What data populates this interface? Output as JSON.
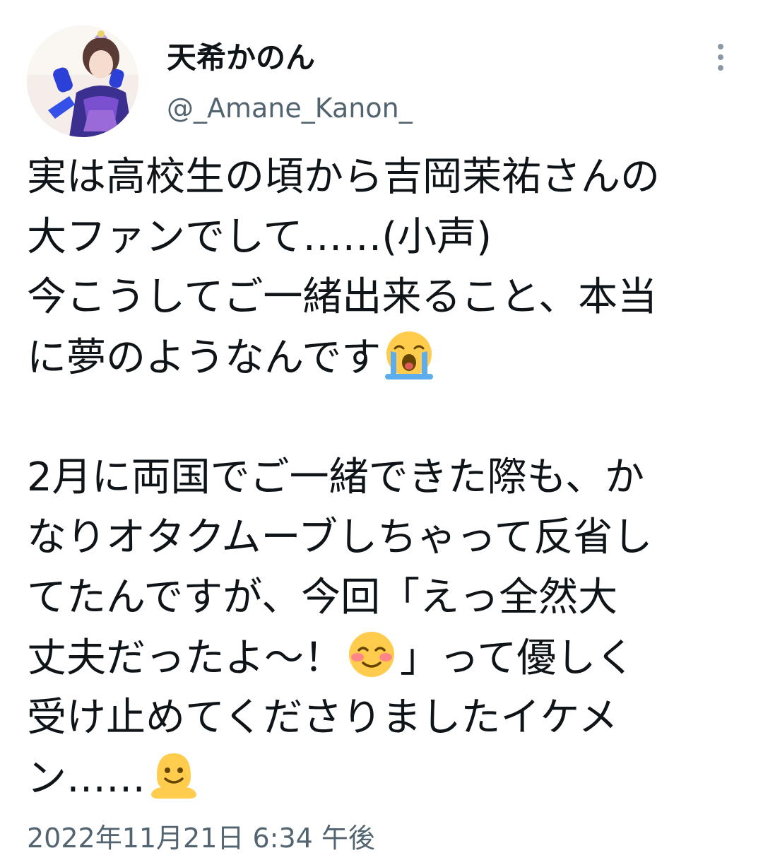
{
  "user": {
    "display_name": "天希かのん",
    "handle": "@_Amane_Kanon_",
    "avatar_icon": "profile-photo"
  },
  "menu": {
    "icon": "more-vertical-icon"
  },
  "tweet": {
    "lines": [
      "実は高校生の頃から吉岡茉祐さんの",
      "大ファンでして……(小声)",
      "今こうしてご一緒出来ること、本当",
      "に夢のようなんです",
      "",
      "2月に両国でご一緒できた際も、か",
      "なりオタクムーブしちゃって反省し",
      "てたんですが、今回「えっ全然大",
      "丈夫だったよ〜！",
      "」って優しく",
      "受け止めてくださりましたイケメ",
      "ン……"
    ],
    "emojis": {
      "crying": "loudly-crying-face-emoji",
      "smiling": "smiling-face-emoji",
      "melting": "melting-face-emoji"
    },
    "timestamp": "2022年11月21日 6:34 午後"
  },
  "colors": {
    "text": "#0f1419",
    "secondary": "#536471",
    "background": "#ffffff"
  }
}
